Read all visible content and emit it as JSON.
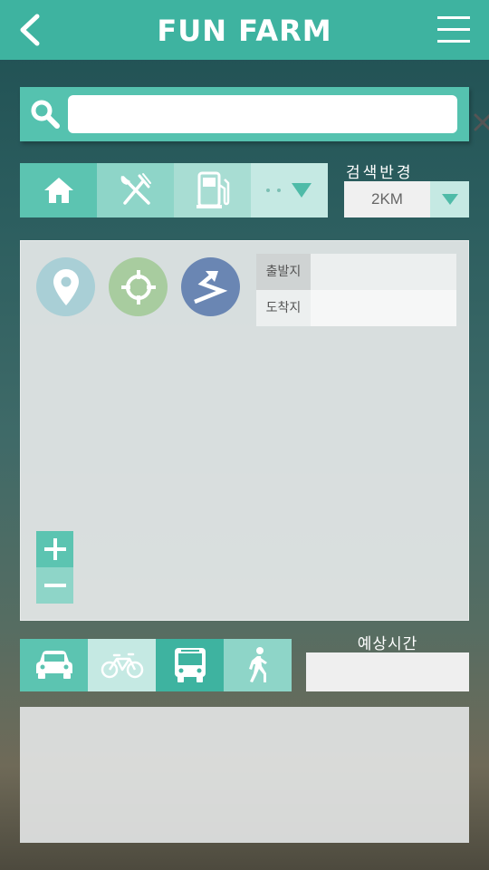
{
  "header": {
    "title": "FUN FARM",
    "back_icon": "chevron-left-icon",
    "menu_icon": "hamburger-menu-icon"
  },
  "search": {
    "value": "",
    "placeholder": "",
    "search_icon": "search-icon",
    "clear_icon": "close-icon"
  },
  "categories": [
    {
      "name": "home",
      "icon": "home-icon",
      "active": true
    },
    {
      "name": "food",
      "icon": "fork-knife-icon",
      "active": false
    },
    {
      "name": "fuel",
      "icon": "fuel-pump-icon",
      "active": false
    },
    {
      "name": "more",
      "icon": "more-dots-dropdown-icon",
      "active": false
    }
  ],
  "radius": {
    "label": "검색반경",
    "value": "2KM"
  },
  "map": {
    "buttons": [
      {
        "name": "pin",
        "icon": "location-pin-icon",
        "color": "#a9cfd6"
      },
      {
        "name": "locate",
        "icon": "crosshair-icon",
        "color": "#a8cc9f"
      },
      {
        "name": "route",
        "icon": "route-arrow-icon",
        "color": "#6a86b3"
      }
    ],
    "start_label": "출발지",
    "start_value": "",
    "end_label": "도착지",
    "end_value": "",
    "zoom_in_icon": "plus-icon",
    "zoom_out_icon": "minus-icon"
  },
  "transport": {
    "modes": [
      {
        "name": "car",
        "icon": "car-icon"
      },
      {
        "name": "bike",
        "icon": "bicycle-icon",
        "selected": true
      },
      {
        "name": "bus",
        "icon": "bus-icon"
      },
      {
        "name": "walk",
        "icon": "walking-person-icon"
      }
    ],
    "eta_label": "예상시간",
    "eta_value": ""
  },
  "colors": {
    "accent": "#3eb3a0",
    "accent_light": "#8ed5c8",
    "accent_pale": "#c5e9e3"
  }
}
